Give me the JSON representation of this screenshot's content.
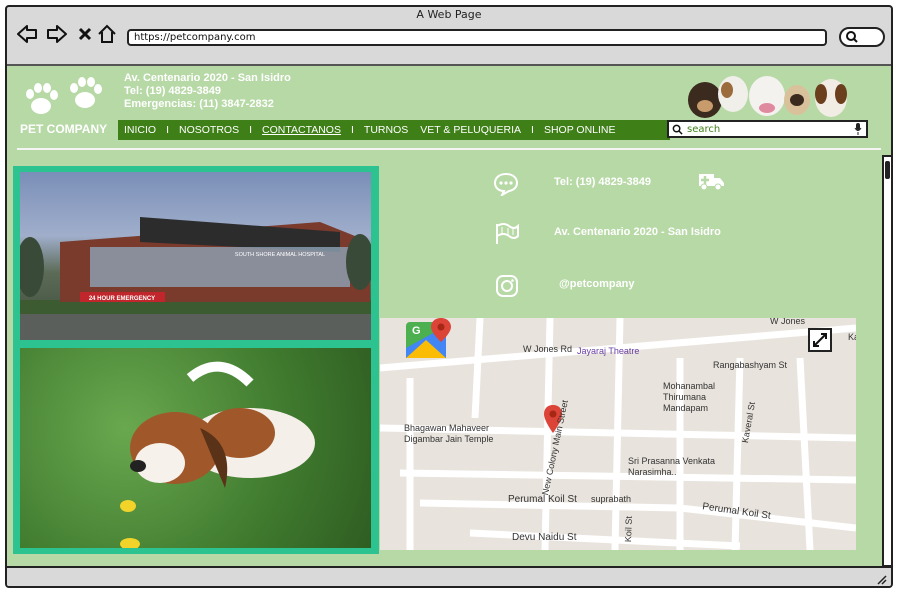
{
  "browser": {
    "window_title": "A Web Page",
    "url": "https://petcompany.com"
  },
  "header": {
    "address": "Av. Centenario 2020 - San Isidro",
    "phone": "Tel: (19) 4829-3849",
    "emergency": "Emergencias: (11) 3847-2832",
    "logo_text": "PET COMPANY"
  },
  "nav": {
    "items": [
      "INICIO",
      "NOSOTROS",
      "CONTACTANOS",
      "TURNOS",
      "VET & PELUQUERIA",
      "SHOP ONLINE"
    ],
    "separator": "I",
    "active": "CONTACTANOS"
  },
  "search": {
    "placeholder": "search"
  },
  "contact": {
    "phone": "Tel: (19) 4829-3849",
    "address": "Av. Centenario 2020 - San Isidro",
    "instagram": "@petcompany"
  },
  "photo1": {
    "sign_text": "24 HOUR EMERGENCY",
    "building_text": "SOUTH SHORE ANIMAL HOSPITAL"
  },
  "map": {
    "labels": [
      "W Jones Rd",
      "Jayaraj Theatre",
      "Rangabashyam St",
      "Mohanambal Thirumana Mandapam",
      "Bhagawan Mahaveer Digambar Jain Temple",
      "New Colony Main Street",
      "Sri Prasanna Venkata Narasimha..",
      "Kaveral St",
      "Perumal Koil St",
      "suprabath",
      "Devu Naidu St",
      "W Jones",
      "Koil St",
      "Ka"
    ]
  },
  "colors": {
    "page_bg": "#b7d9a6",
    "nav_bg": "#3f7f18",
    "frame": "#2cc391"
  }
}
